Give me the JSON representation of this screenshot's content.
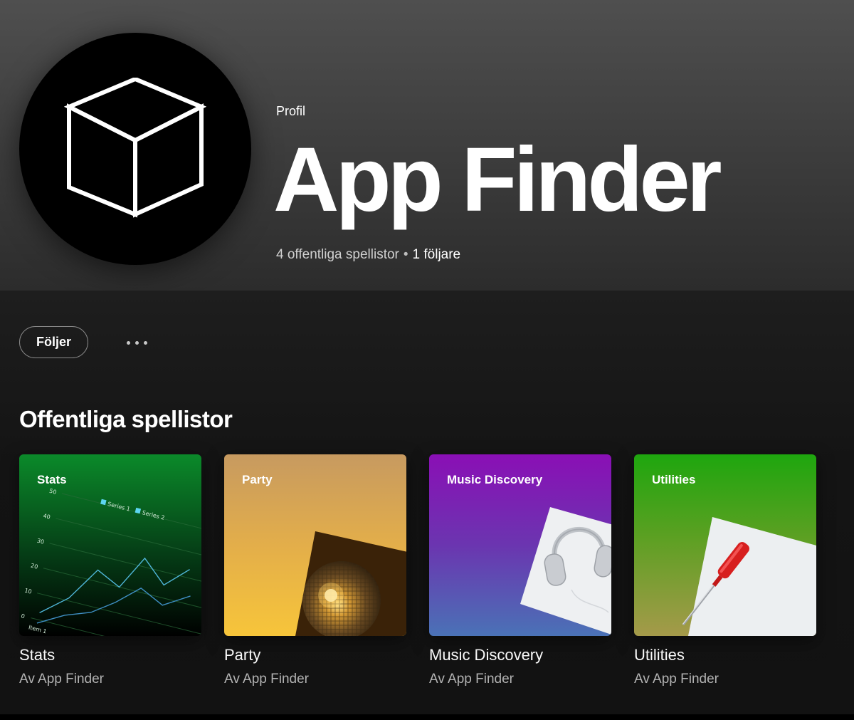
{
  "profile": {
    "kind": "Profil",
    "name": "App Finder",
    "playlists_count_text": "4 offentliga spellistor",
    "separator": "•",
    "followers_text": "1 följare",
    "avatar_icon": "cube-icon"
  },
  "actions": {
    "follow_label": "Följer",
    "more_icon": "more-options-icon"
  },
  "section": {
    "title": "Offentliga spellistor"
  },
  "playlists": [
    {
      "cover_label": "Stats",
      "name": "Stats",
      "subtitle": "Av App Finder",
      "cover_colors": [
        "#0b8a2a",
        "#053d16",
        "#000000"
      ],
      "chart": {
        "y_ticks": [
          "50",
          "40",
          "30",
          "20",
          "10",
          "0"
        ],
        "x_tick": "Item 1",
        "legend": [
          "Series 1",
          "Series 2"
        ],
        "legend_color": "#5dd6f0"
      }
    },
    {
      "cover_label": "Party",
      "name": "Party",
      "subtitle": "Av App Finder",
      "cover_colors": [
        "#c79a60",
        "#e3ae4a",
        "#f5c23c"
      ],
      "image": "disco-ball"
    },
    {
      "cover_label": "Music Discovery",
      "name": "Music Discovery",
      "subtitle": "Av App Finder",
      "cover_colors": [
        "#8a0fb5",
        "#6b35b0",
        "#4a72b6"
      ],
      "image": "headphones"
    },
    {
      "cover_label": "Utilities",
      "name": "Utilities",
      "subtitle": "Av App Finder",
      "cover_colors": [
        "#1ea60e",
        "#5ba022",
        "#a59a4a"
      ],
      "image": "screwdriver"
    }
  ]
}
